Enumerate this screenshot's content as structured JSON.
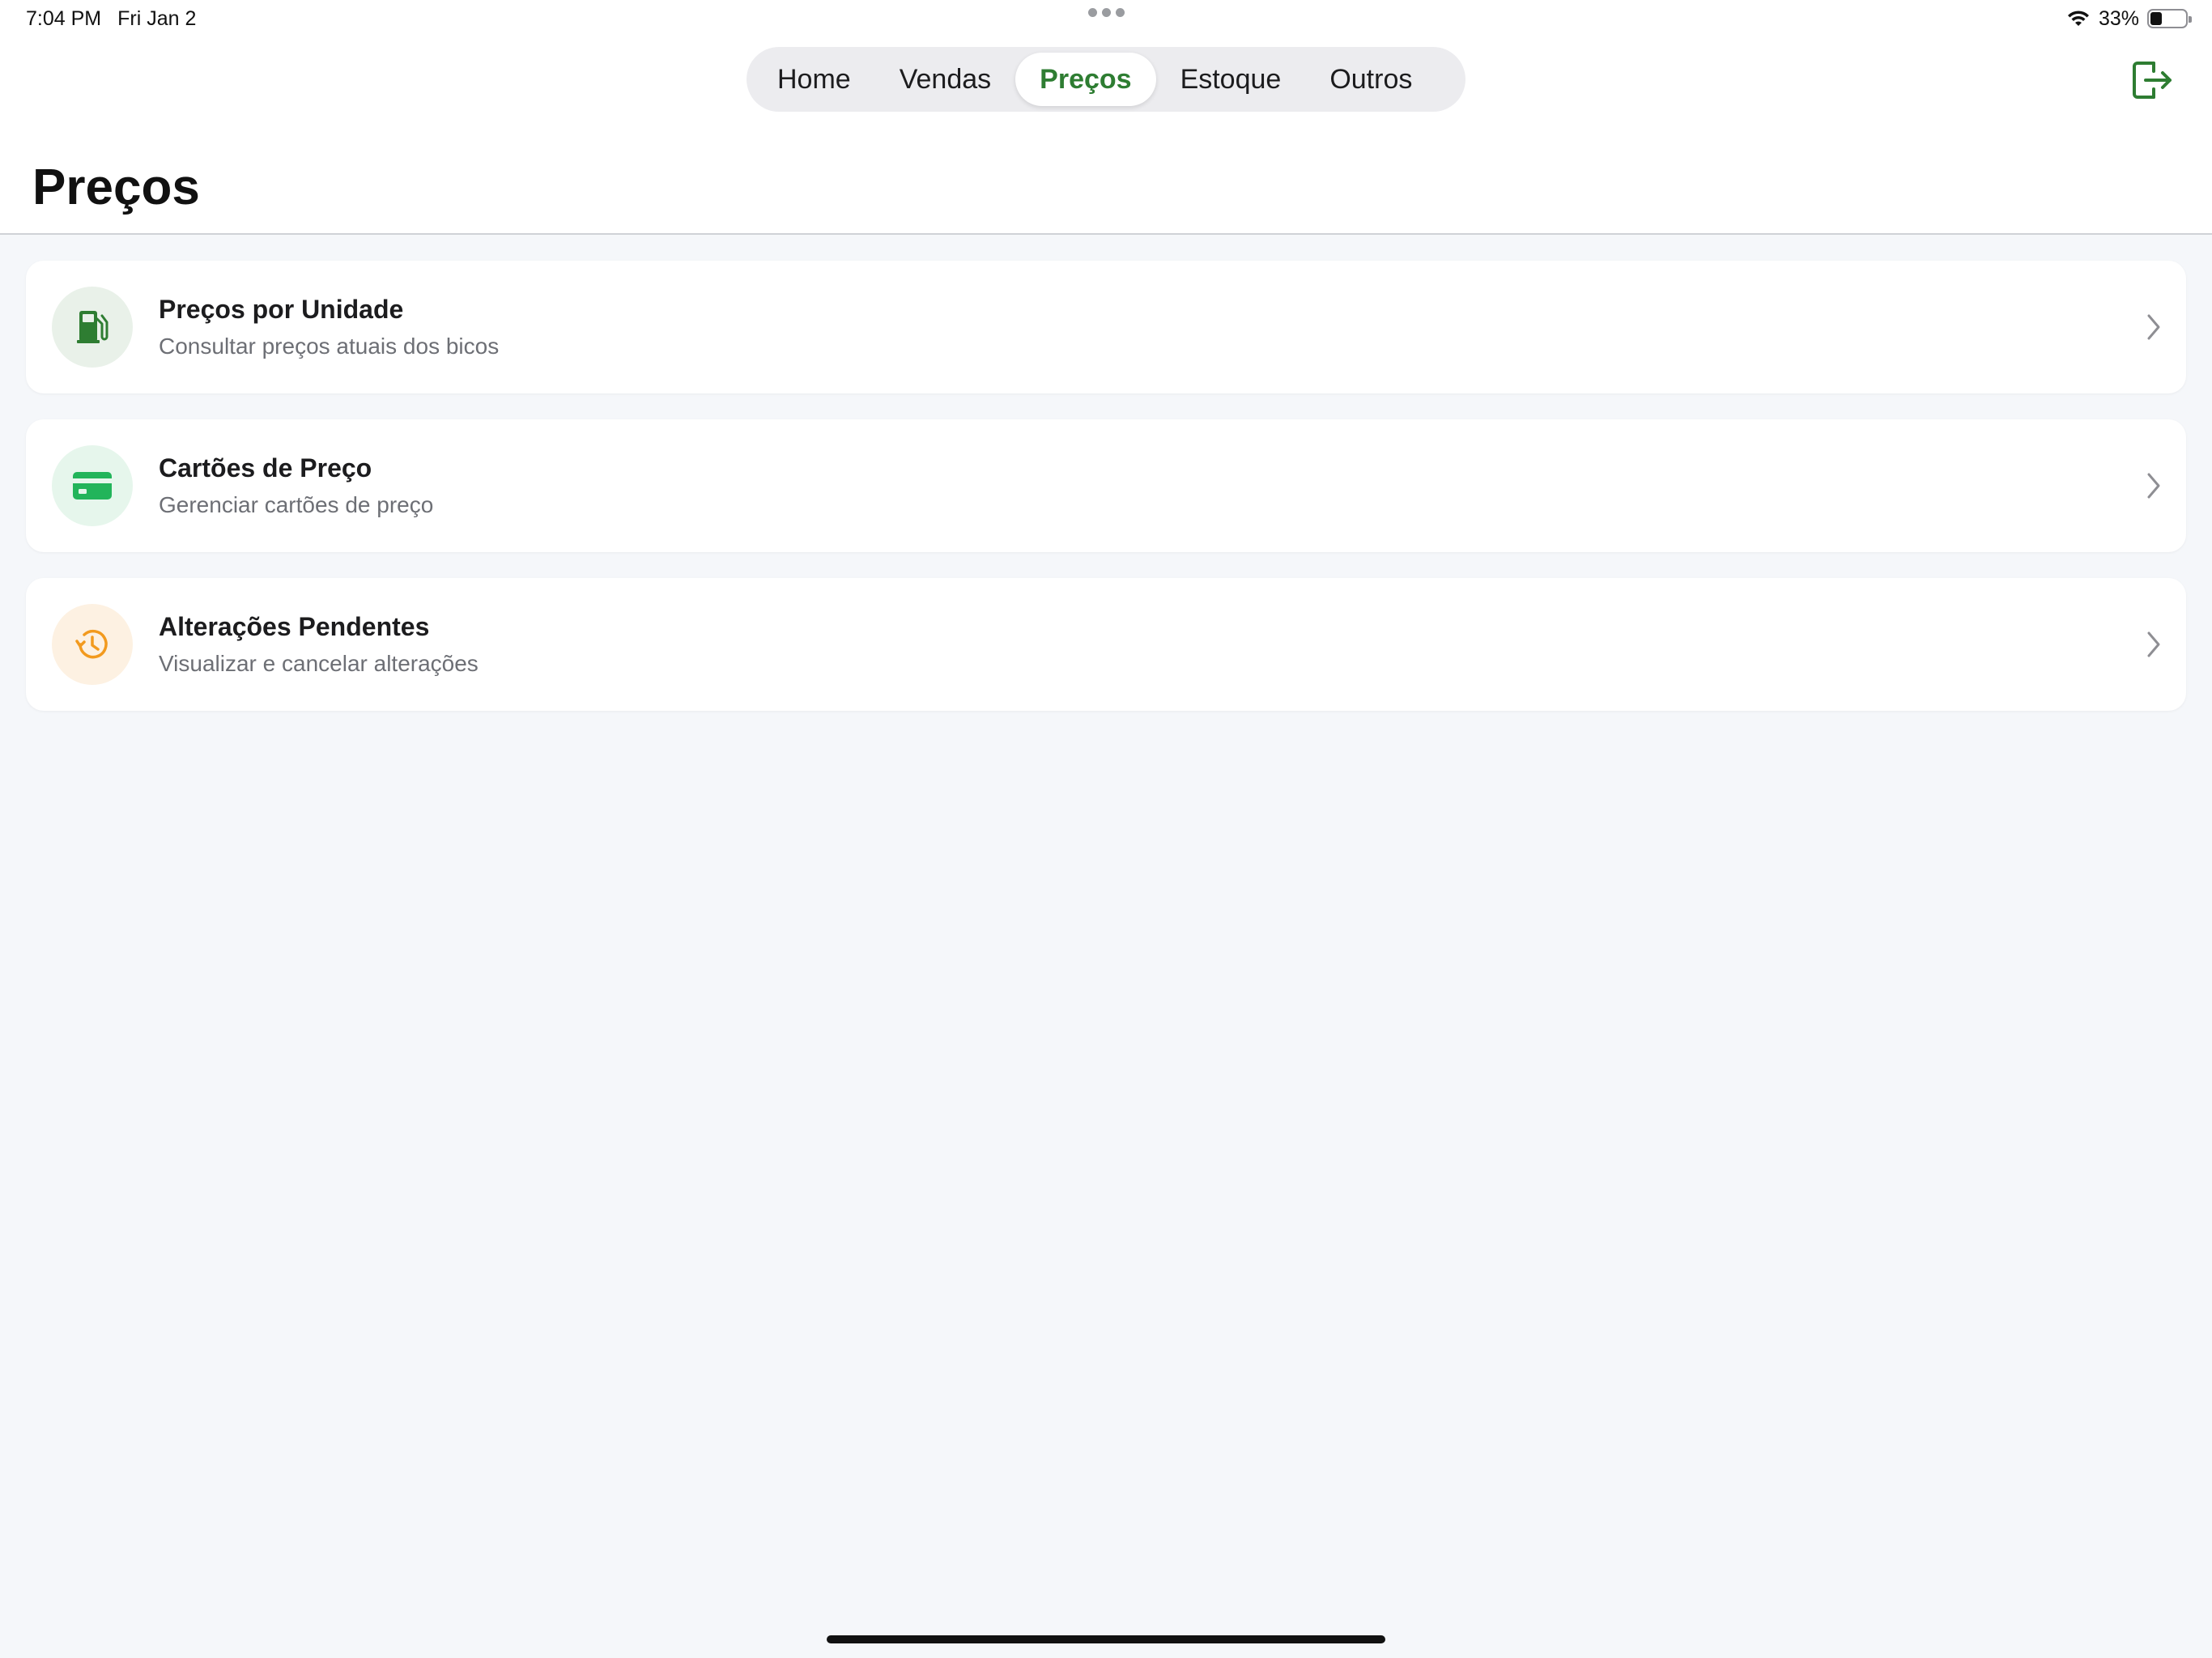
{
  "status_bar": {
    "time": "7:04 PM",
    "date": "Fri Jan 2",
    "battery_percent": "33%",
    "battery_level": 0.33
  },
  "tabs": [
    {
      "label": "Home",
      "active": false
    },
    {
      "label": "Vendas",
      "active": false
    },
    {
      "label": "Preços",
      "active": true
    },
    {
      "label": "Estoque",
      "active": false
    },
    {
      "label": "Outros",
      "active": false
    }
  ],
  "page": {
    "title": "Preços"
  },
  "menu_items": [
    {
      "title": "Preços por Unidade",
      "subtitle": "Consultar preços atuais dos bicos",
      "icon": "fuel-pump-icon",
      "icon_color": "#2e7d32",
      "icon_bg": "#e9f1e9"
    },
    {
      "title": "Cartões de Preço",
      "subtitle": "Gerenciar cartões de preço",
      "icon": "credit-card-icon",
      "icon_color": "#22b45a",
      "icon_bg": "#e6f6ec"
    },
    {
      "title": "Alterações Pendentes",
      "subtitle": "Visualizar e cancelar alterações",
      "icon": "history-clock-icon",
      "icon_color": "#f29a1e",
      "icon_bg": "#fdf1e2"
    }
  ],
  "colors": {
    "accent": "#2e7d32",
    "background": "#f5f7fa"
  }
}
